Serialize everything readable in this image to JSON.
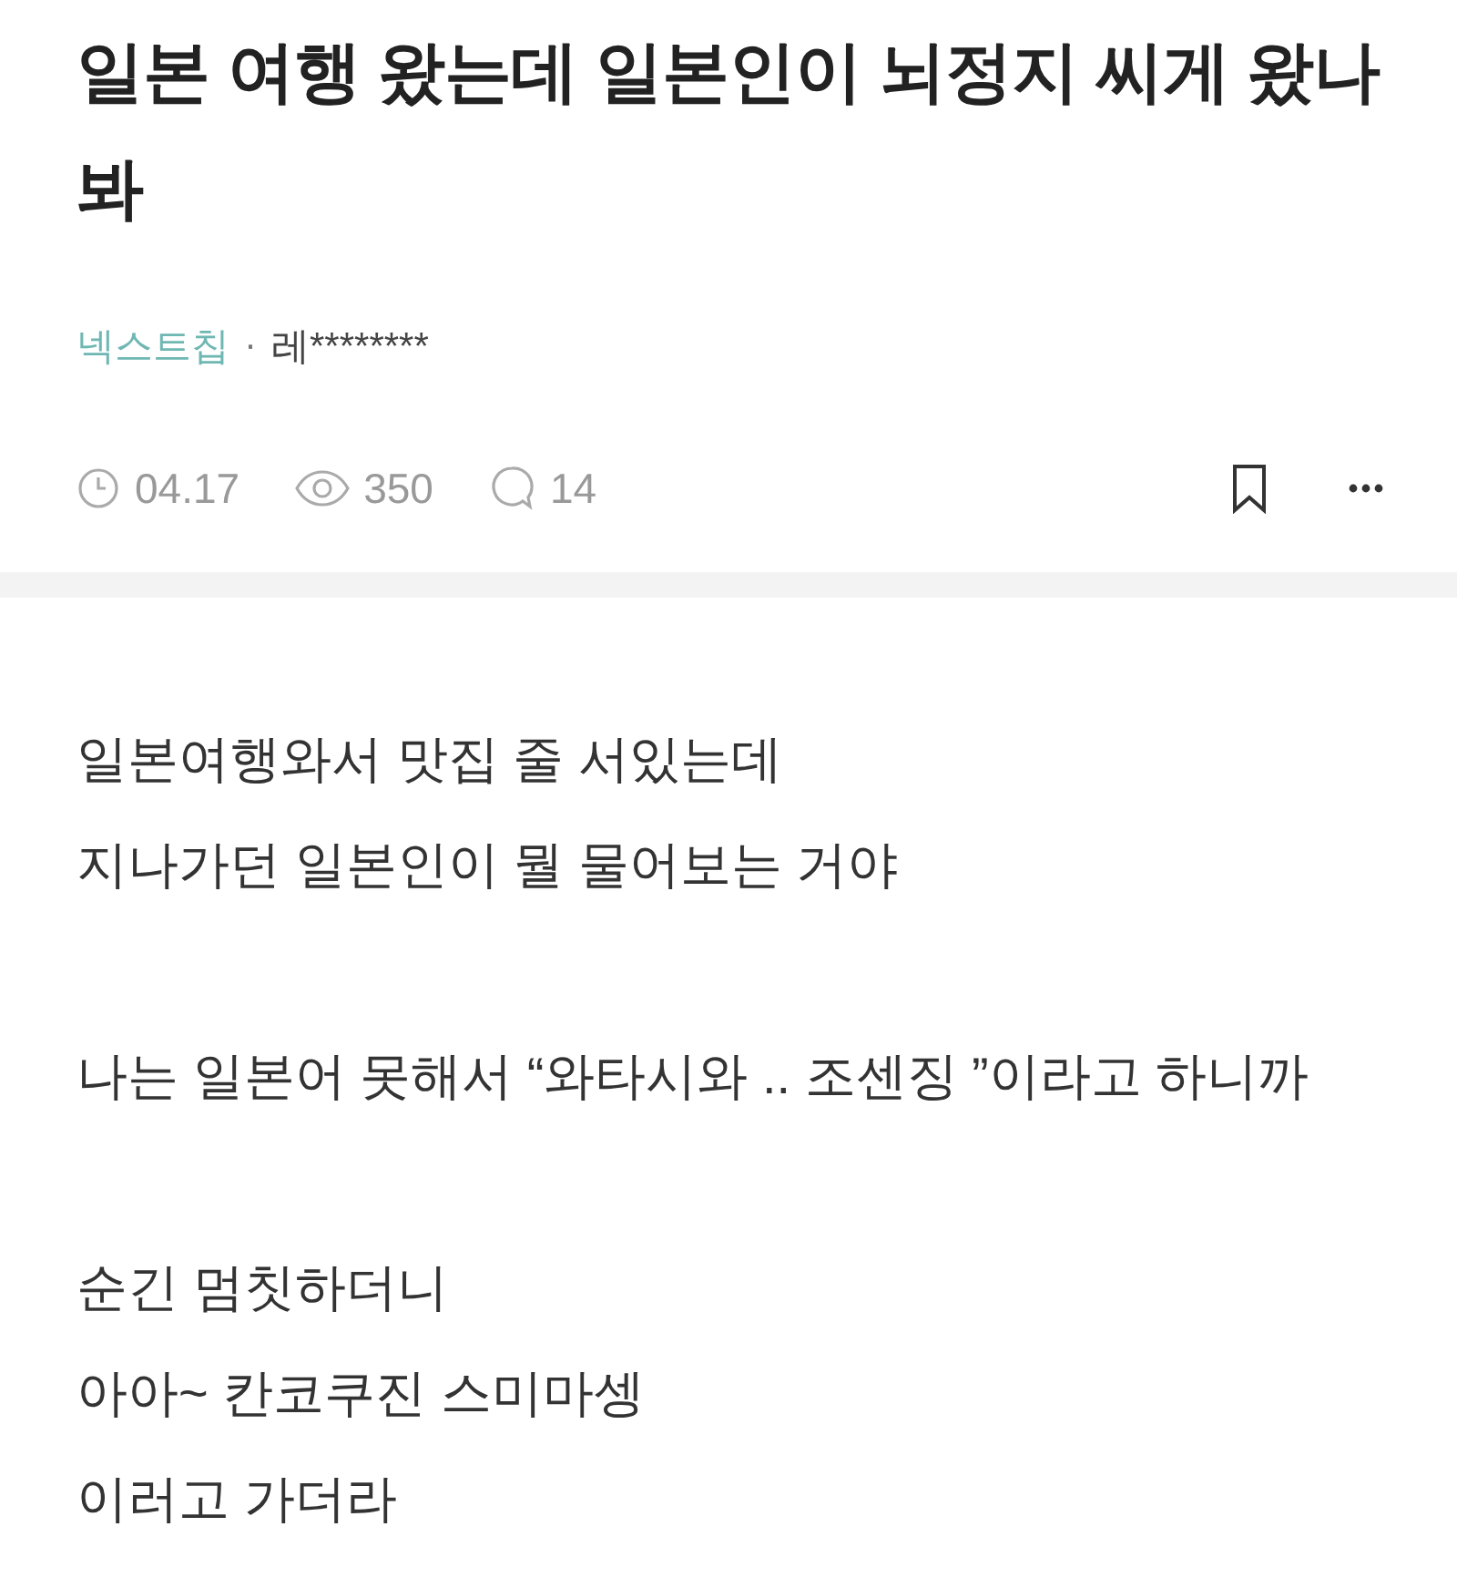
{
  "post": {
    "title": "일본 여행 왔는데 일본인이 뇌정지 씨게 왔나 봐",
    "channel": "넥스트칩",
    "separator": "·",
    "author": "레********",
    "date": "04.17",
    "views": "350",
    "comments": "14",
    "bookmarked": false
  },
  "body": {
    "paragraphs": [
      [
        "일본여행와서 맛집 줄 서있는데",
        "지나가던 일본인이 뭘 물어보는 거야"
      ],
      [
        "나는 일본어 못해서 “와타시와 .. 조센징 ”이라고 하니까"
      ],
      [
        "순긴 멈칫하더니",
        "아아~ 칸코쿠진 스미마셍",
        "이러고 가더라"
      ]
    ]
  }
}
